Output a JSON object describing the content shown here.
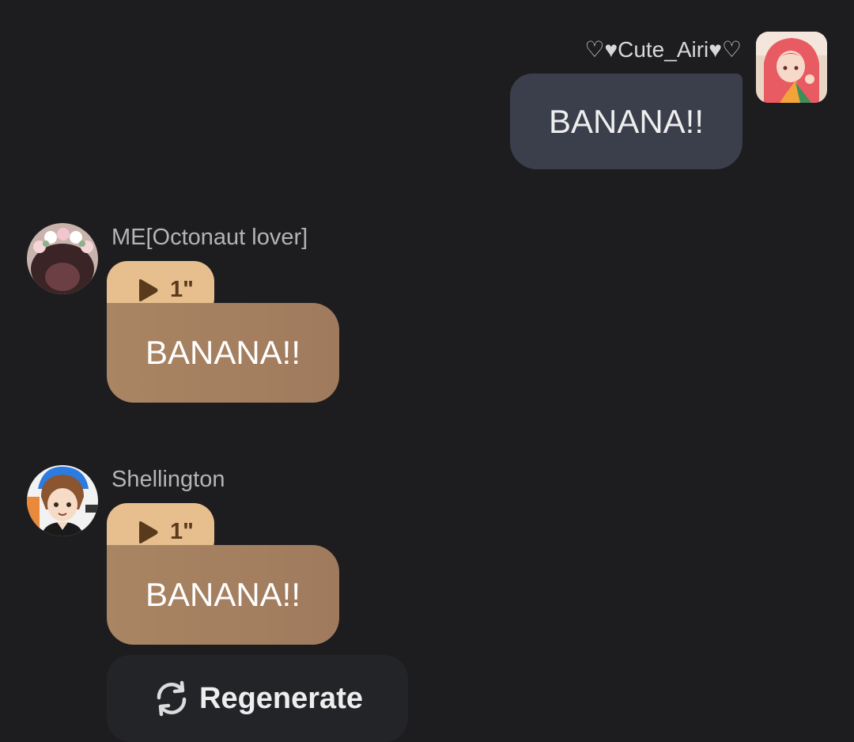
{
  "outgoing": {
    "username": "♡♥Cute_Airi♥♡",
    "text": "BANANA!!",
    "avatar_icon": "anime-girl-avatar"
  },
  "messages": [
    {
      "character": "ME[Octonaut lover]",
      "voice_duration": "1\"",
      "text": "BANANA!!",
      "avatar_icon": "flower-crown-avatar"
    },
    {
      "character": "Shellington",
      "voice_duration": "1\"",
      "text": "BANANA!!",
      "avatar_icon": "anime-boy-avatar"
    }
  ],
  "regenerate_label": "Regenerate",
  "colors": {
    "background": "#1d1d20",
    "outgoing_bubble": "#3b3f4c",
    "incoming_bubble": "#a98563",
    "voice_chip": "#e7bf8e"
  }
}
